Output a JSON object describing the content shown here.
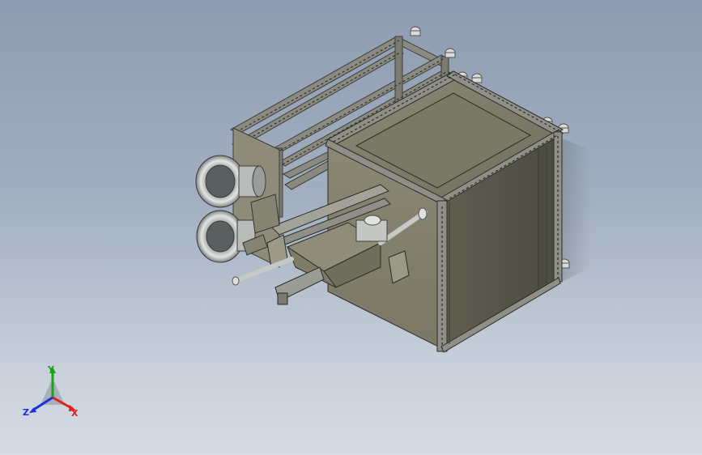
{
  "viewport": {
    "background_top": "#8e9cb1",
    "background_bottom": "#d6dce5"
  },
  "model": {
    "body_color": "#8d8b76",
    "body_dark": "#5e5c4d",
    "frame_color": "#7a7a72",
    "lens_color": "#c9cbc8"
  },
  "triad": {
    "x_label": "X",
    "y_label": "Y",
    "z_label": "Z",
    "x_color": "#e0201c",
    "y_color": "#1aa31a",
    "z_color": "#1c2fd8"
  }
}
